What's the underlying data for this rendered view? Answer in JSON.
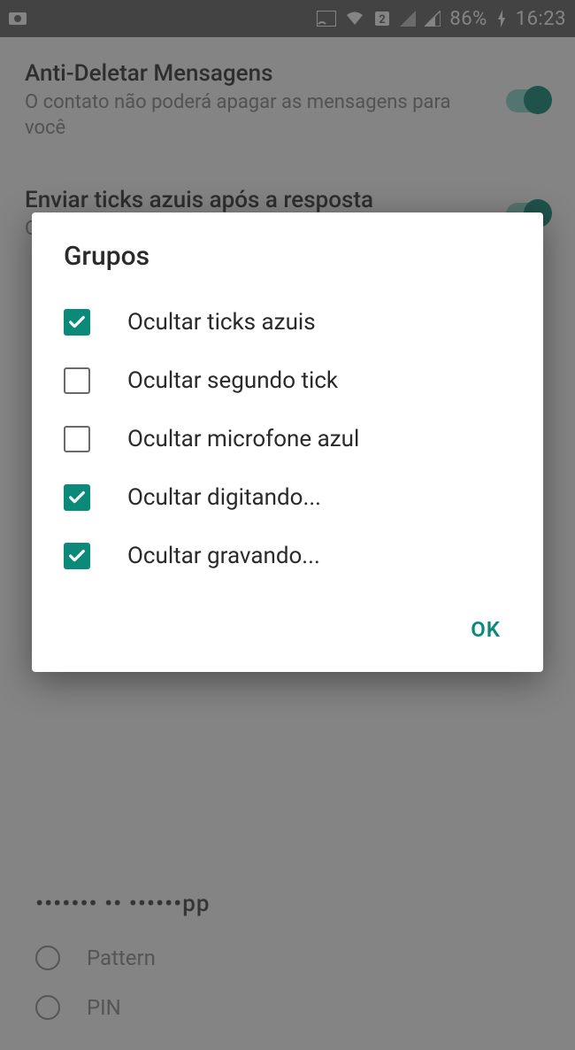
{
  "status_bar": {
    "battery": "86%",
    "time": "16:23"
  },
  "background": {
    "setting1": {
      "title": "Anti-Deletar Mensagens",
      "desc": "O contato não poderá apagar as mensagens para você"
    },
    "setting2": {
      "title": "Enviar ticks azuis após a resposta",
      "desc": "O contato só verá ticks azuis depois que"
    },
    "bottom_title": "••••••• •• ••••••pp",
    "radio1": "Pattern",
    "radio2": "PIN"
  },
  "dialog": {
    "title": "Grupos",
    "options": [
      {
        "label": "Ocultar ticks azuis",
        "checked": true
      },
      {
        "label": "Ocultar segundo tick",
        "checked": false
      },
      {
        "label": "Ocultar microfone azul",
        "checked": false
      },
      {
        "label": "Ocultar digitando...",
        "checked": true
      },
      {
        "label": "Ocultar gravando...",
        "checked": true
      }
    ],
    "ok": "OK"
  }
}
